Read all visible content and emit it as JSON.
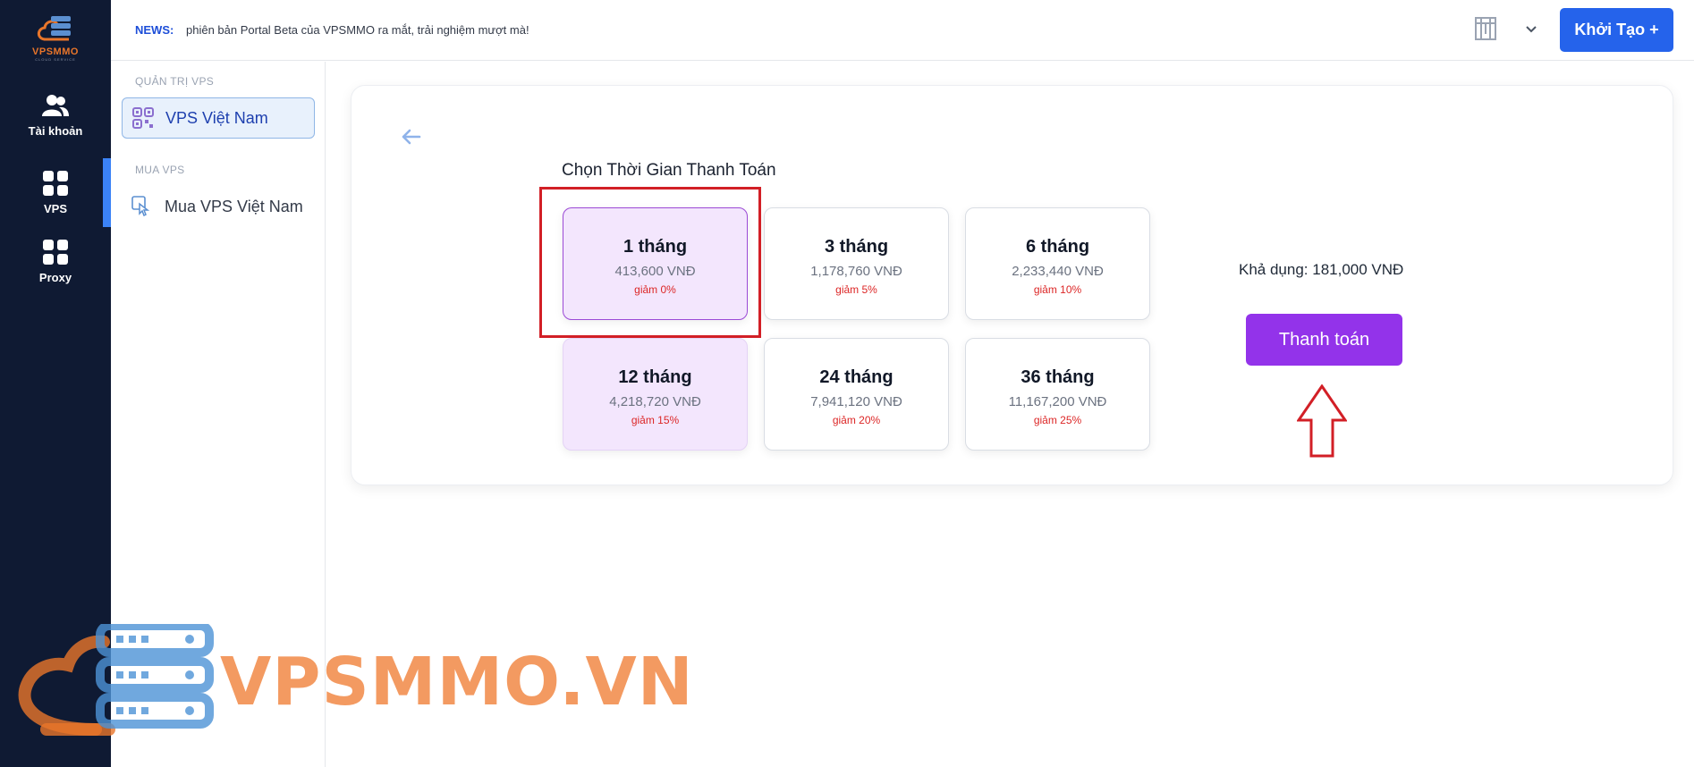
{
  "brand": {
    "name": "VPSMMO",
    "tagline": "CLOUD SERVICE",
    "watermark": "VPSMMO.VN",
    "colors": {
      "rail_bg": "#0f1a33",
      "accent_blue": "#2563eb",
      "accent_purple": "#9333ea",
      "orange": "#e8752a",
      "discount_red": "#dc2626"
    }
  },
  "rail": {
    "items": [
      {
        "label": "Tài khoản",
        "icon": "users-icon",
        "active": false
      },
      {
        "label": "VPS",
        "icon": "grid-icon",
        "active": true
      },
      {
        "label": "Proxy",
        "icon": "grid-icon",
        "active": false
      }
    ]
  },
  "topbar": {
    "news_label": "NEWS:",
    "news_text": "phiên bản Portal Beta của VPSMMO ra mắt, trải nghiệm mượt mà!",
    "language_icon": "flag-icon",
    "dropdown_icon": "chevron-down-icon",
    "create_button": "Khởi Tạo +"
  },
  "subnav": {
    "sections": [
      {
        "title": "QUẢN TRỊ VPS",
        "items": [
          {
            "label": "VPS Việt Nam",
            "icon": "qr-icon",
            "active": true
          }
        ]
      },
      {
        "title": "MUA VPS",
        "items": [
          {
            "label": "Mua VPS Việt Nam",
            "icon": "tap-icon",
            "active": false
          }
        ]
      }
    ]
  },
  "main": {
    "back_icon": "arrow-left-icon",
    "title": "Chọn Thời Gian Thanh Toán",
    "selected_plan": "1 tháng",
    "plans": [
      {
        "duration": "1 tháng",
        "price": "413,600 VNĐ",
        "discount": "giảm 0%",
        "state": "selected"
      },
      {
        "duration": "3 tháng",
        "price": "1,178,760 VNĐ",
        "discount": "giảm 5%",
        "state": "normal"
      },
      {
        "duration": "6 tháng",
        "price": "2,233,440 VNĐ",
        "discount": "giảm 10%",
        "state": "normal"
      },
      {
        "duration": "12 tháng",
        "price": "4,218,720 VNĐ",
        "discount": "giảm 15%",
        "state": "tinted"
      },
      {
        "duration": "24 tháng",
        "price": "7,941,120 VNĐ",
        "discount": "giảm 20%",
        "state": "normal"
      },
      {
        "duration": "36 tháng",
        "price": "11,167,200 VNĐ",
        "discount": "giảm 25%",
        "state": "normal"
      }
    ],
    "balance": "Khả dụng: 181,000 VNĐ",
    "pay_button": "Thanh toán"
  }
}
